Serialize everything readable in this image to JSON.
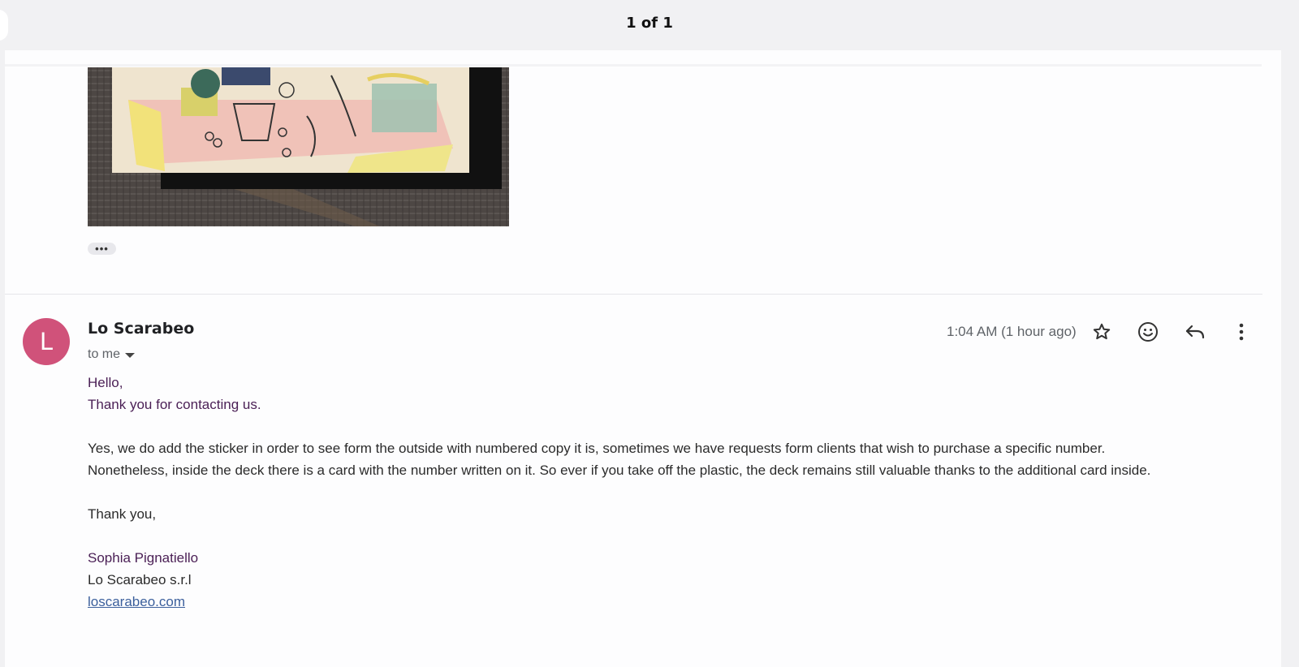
{
  "viewer": {
    "page_counter": "1 of 1"
  },
  "message": {
    "avatar_initial": "L",
    "avatar_color": "#d0527a",
    "sender": "Lo Scarabeo",
    "recipient_label": "to me",
    "timestamp": "1:04 AM (1 hour ago)",
    "actions": [
      "star-icon",
      "emoji-icon",
      "reply-icon",
      "more-vert-icon"
    ],
    "body": {
      "greeting": "Hello,",
      "thanks_line": "Thank you for contacting us.",
      "paragraph_line1": "Yes, we do add the sticker in order to see form the outside with numbered copy it is, sometimes we have requests form clients that wish to purchase a specific number.",
      "paragraph_line2": "Nonetheless, inside the deck there is a card with the number written on it. So ever if you take off the plastic, the deck remains still valuable thanks to the additional card inside.",
      "closing": "Thank you,",
      "signature_name": "Sophia Pignatiello",
      "signature_company": "Lo Scarabeo s.r.l",
      "signature_link": "loscarabeo.com"
    }
  },
  "quoted": {
    "ellipsis": "•••"
  }
}
